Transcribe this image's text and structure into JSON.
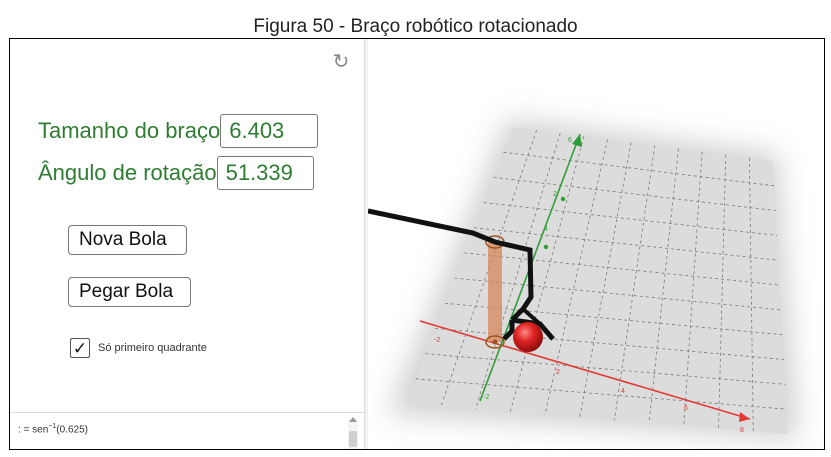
{
  "figure": {
    "caption": "Figura 50 - Braço robótico rotacionado"
  },
  "panel": {
    "arm_length": {
      "label": "Tamanho do braço",
      "value": "6.403"
    },
    "rotation_angle": {
      "label": "Ângulo de rotação",
      "value": "51.339"
    },
    "new_ball_button": "Nova Bola",
    "grab_ball_button": "Pegar Bola",
    "first_quadrant_checkbox": {
      "label": "Só primeiro quadrante",
      "checked": true
    }
  },
  "input_bar": {
    "prefix": ": =  sen",
    "superscript": "−1",
    "argument": "(0.625)"
  },
  "view3d": {
    "axes": {
      "x_axis_color": "#e53935",
      "y_axis_color": "#2e9e3a",
      "x_tick_labels": [
        "-2",
        "2",
        "4",
        "6",
        "8"
      ],
      "y_tick_labels": [
        "-2",
        "2",
        "4",
        "6"
      ]
    },
    "arm_color": "#111111",
    "pillar_color": "#d7875a",
    "ball_color": "#e02424",
    "icons": [
      "refresh-icon",
      "check-icon"
    ]
  }
}
